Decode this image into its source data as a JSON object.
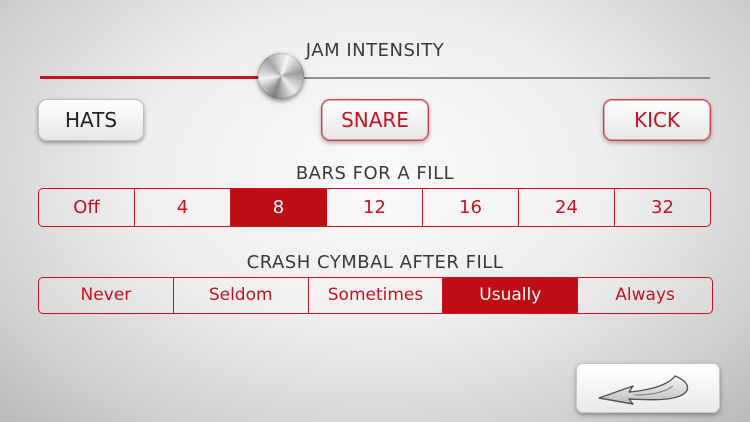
{
  "jam_intensity": {
    "label": "JAM INTENSITY",
    "value_fraction": 0.36
  },
  "pads": {
    "hats": {
      "label": "HATS",
      "active": false
    },
    "snare": {
      "label": "SNARE",
      "active": true
    },
    "kick": {
      "label": "KICK",
      "active": true
    }
  },
  "bars_for_fill": {
    "label": "BARS FOR A FILL",
    "options": [
      "Off",
      "4",
      "8",
      "12",
      "16",
      "24",
      "32"
    ],
    "selected": "8"
  },
  "crash_cymbal": {
    "label": "CRASH CYMBAL AFTER FILL",
    "options": [
      "Never",
      "Seldom",
      "Sometimes",
      "Usually",
      "Always"
    ],
    "selected": "Usually"
  },
  "back_button": {
    "icon": "back-arrow-icon"
  },
  "colors": {
    "accent": "#c4141f",
    "selected_bg": "#bf0d14",
    "text": "#3a3a3a"
  }
}
